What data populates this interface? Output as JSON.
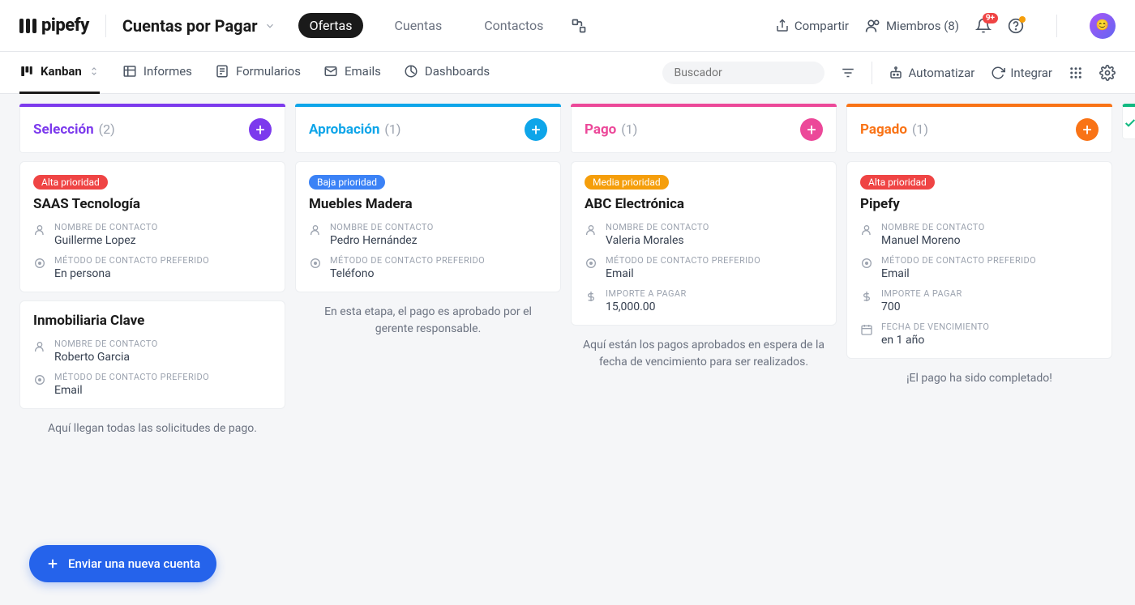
{
  "header": {
    "logo": "pipefy",
    "pipe_name": "Cuentas por Pagar",
    "nav": [
      "Ofertas",
      "Cuentas",
      "Contactos"
    ],
    "nav_active": 0,
    "share": "Compartir",
    "members": "Miembros (8)",
    "notif_badge": "9+"
  },
  "toolbar": {
    "tabs": [
      "Kanban",
      "Informes",
      "Formularios",
      "Emails",
      "Dashboards"
    ],
    "active": 0,
    "search_placeholder": "Buscador",
    "automate": "Automatizar",
    "integrate": "Integrar"
  },
  "columns": [
    {
      "title": "Selección",
      "count": "(2)",
      "color": "#7c3aed",
      "desc": "Aquí llegan todas las solicitudes de pago.",
      "cards": [
        {
          "prio": "Alta prioridad",
          "prio_class": "alta",
          "title": "SAAS Tecnología",
          "fields": [
            {
              "icon": "user",
              "label": "NOMBRE DE CONTACTO",
              "value": "Guillerme Lopez"
            },
            {
              "icon": "target",
              "label": "MÉTODO DE CONTACTO PREFERIDO",
              "value": "En persona"
            }
          ]
        },
        {
          "title": "Inmobiliaria Clave",
          "fields": [
            {
              "icon": "user",
              "label": "NOMBRE DE CONTACTO",
              "value": "Roberto Garcia"
            },
            {
              "icon": "target",
              "label": "MÉTODO DE CONTACTO PREFERIDO",
              "value": "Email"
            }
          ]
        }
      ]
    },
    {
      "title": "Aprobación",
      "count": "(1)",
      "color": "#0ea5e9",
      "desc": "En esta etapa, el pago es aprobado por el gerente responsable.",
      "cards": [
        {
          "prio": "Baja prioridad",
          "prio_class": "baja",
          "title": "Muebles Madera",
          "fields": [
            {
              "icon": "user",
              "label": "NOMBRE DE CONTACTO",
              "value": "Pedro Hernández"
            },
            {
              "icon": "target",
              "label": "MÉTODO DE CONTACTO PREFERIDO",
              "value": "Teléfono"
            }
          ]
        }
      ]
    },
    {
      "title": "Pago",
      "count": "(1)",
      "color": "#ec4899",
      "desc": "Aquí están los pagos aprobados en espera de la fecha de vencimiento para ser realizados.",
      "cards": [
        {
          "prio": "Media prioridad",
          "prio_class": "media",
          "title": "ABC Electrónica",
          "fields": [
            {
              "icon": "user",
              "label": "NOMBRE DE CONTACTO",
              "value": "Valeria Morales"
            },
            {
              "icon": "target",
              "label": "MÉTODO DE CONTACTO PREFERIDO",
              "value": "Email"
            },
            {
              "icon": "dollar",
              "label": "IMPORTE A PAGAR",
              "value": "15,000.00"
            }
          ]
        }
      ]
    },
    {
      "title": "Pagado",
      "count": "(1)",
      "color": "#f97316",
      "desc": "¡El pago ha sido completado!",
      "cards": [
        {
          "prio": "Alta prioridad",
          "prio_class": "alta",
          "title": "Pipefy",
          "fields": [
            {
              "icon": "user",
              "label": "NOMBRE DE CONTACTO",
              "value": "Manuel Moreno"
            },
            {
              "icon": "target",
              "label": "MÉTODO DE CONTACTO PREFERIDO",
              "value": "Email"
            },
            {
              "icon": "dollar",
              "label": "IMPORTE A PAGAR",
              "value": "700"
            },
            {
              "icon": "cal",
              "label": "FECHA DE VENCIMIENTO",
              "value": "en 1 año"
            }
          ]
        }
      ]
    }
  ],
  "fab": "Enviar una nueva cuenta"
}
